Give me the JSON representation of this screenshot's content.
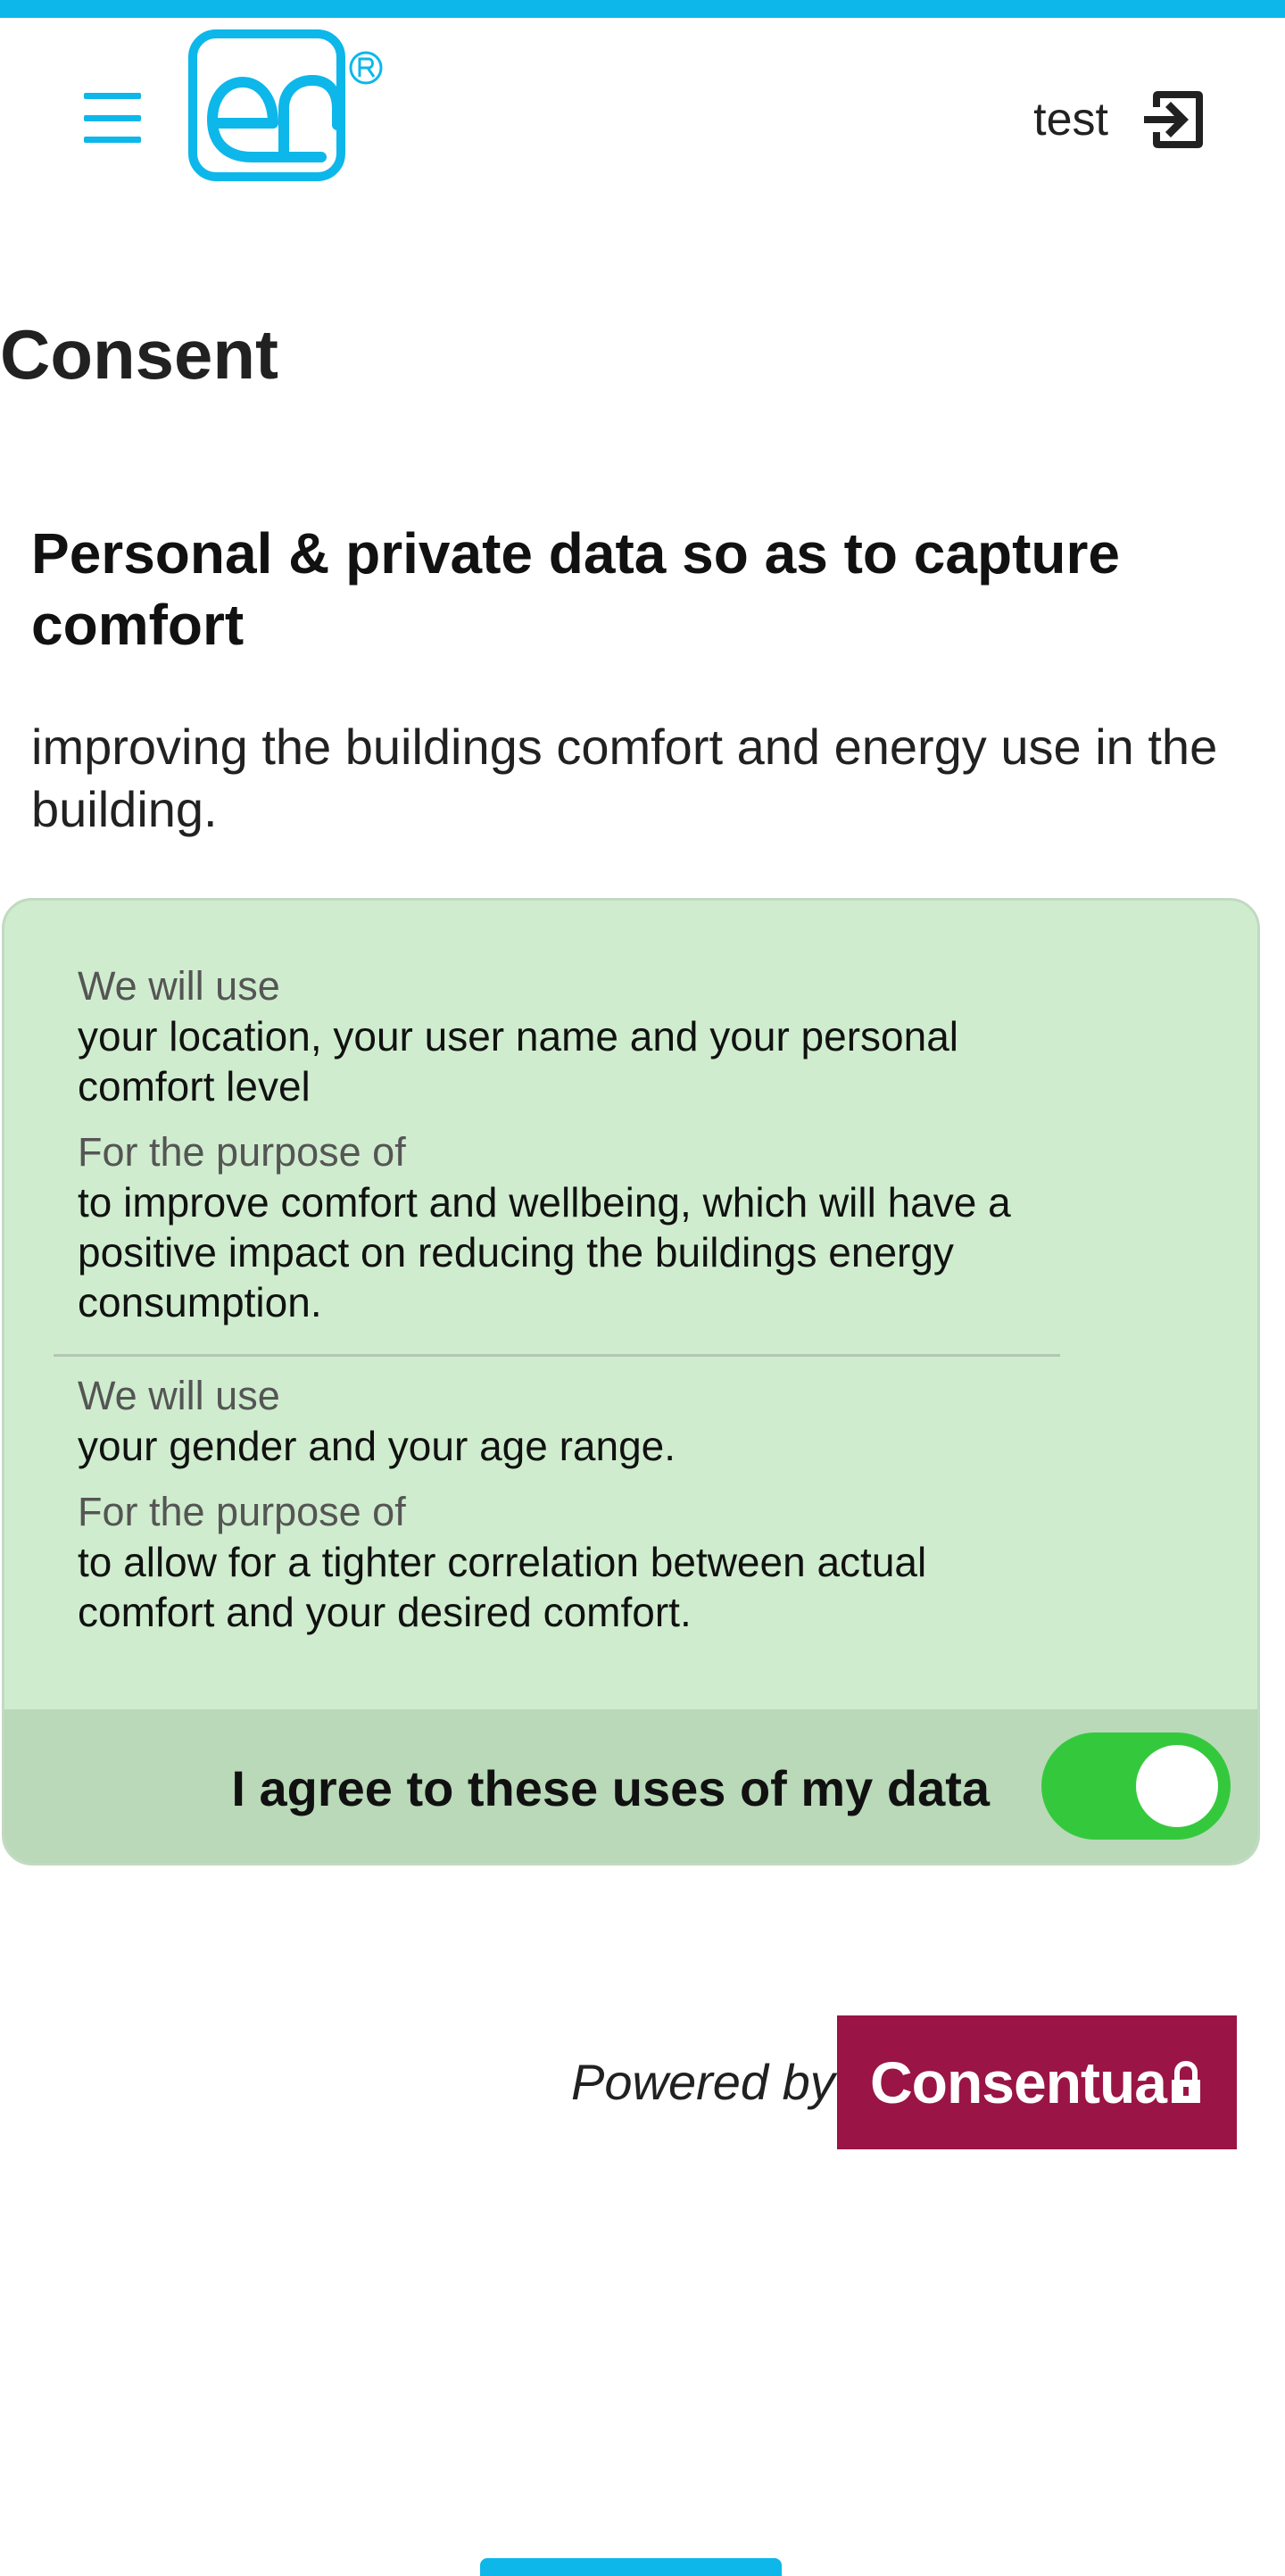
{
  "header": {
    "logo_text": "en",
    "user_name": "test",
    "menu_icon": "hamburger-menu-icon",
    "logout_icon": "logout-icon",
    "accent_color": "#0db7ea"
  },
  "page": {
    "title": "Consent"
  },
  "consent": {
    "title": "Personal & private data so as to capture comfort",
    "description": "improving the buildings comfort and energy use in the building.",
    "uses": [
      {
        "use_label": "We will use",
        "use_value": "your location, your user name and your personal comfort level",
        "purpose_label": "For the purpose of",
        "purpose_value": "to improve comfort and wellbeing, which will have a positive impact on reducing the buildings energy consumption."
      },
      {
        "use_label": "We will use",
        "use_value": "your gender and your age range.",
        "purpose_label": "For the purpose of",
        "purpose_value": "to allow for a tighter correlation between actual comfort and your desired comfort."
      }
    ],
    "agree_label": "I agree to these uses of my data",
    "agree_toggle_on": true,
    "card_color": "#cfedce",
    "toggle_color": "#34c93c"
  },
  "footer": {
    "powered_by": "Powered by",
    "brand": "Consentua",
    "brand_color": "#9a1446"
  }
}
